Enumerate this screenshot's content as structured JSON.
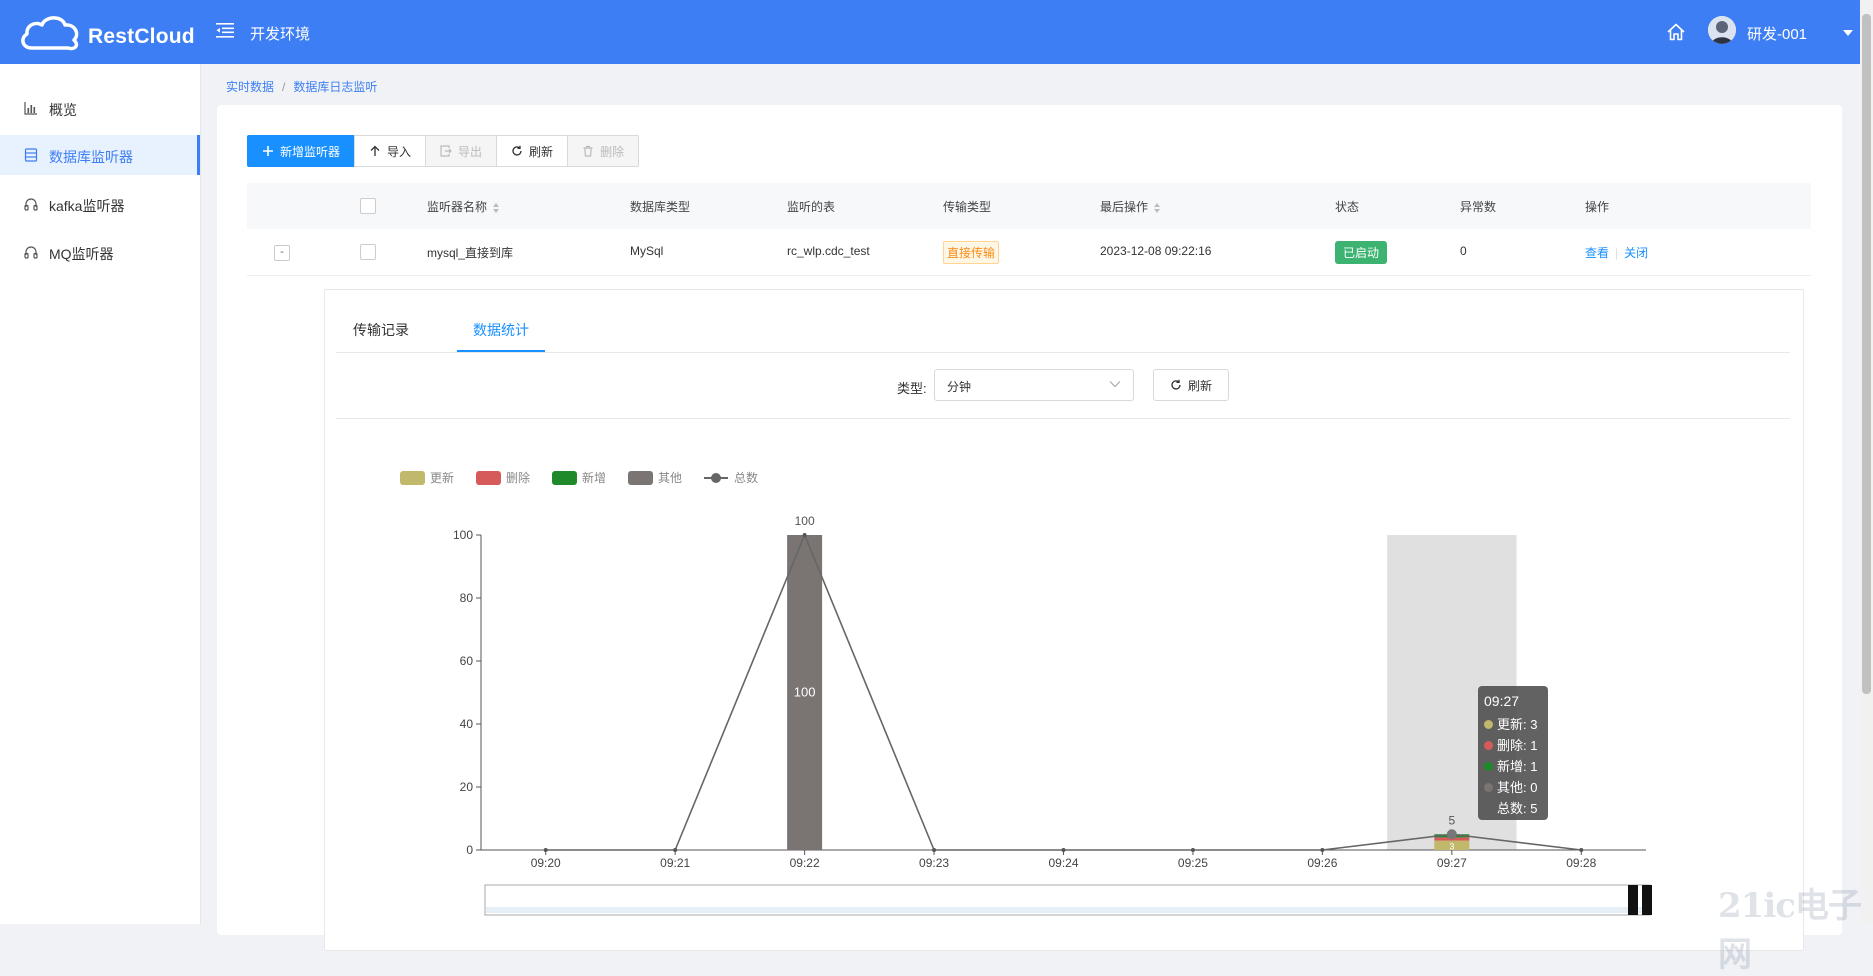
{
  "header": {
    "logo_text": "RestCloud",
    "env_label": "开发环境",
    "user_name": "研发-001",
    "brand_color": "#3d7ef4"
  },
  "sidebar": {
    "items": [
      {
        "label": "概览",
        "icon": "bar-chart-icon",
        "active": false
      },
      {
        "label": "数据库监听器",
        "icon": "database-icon",
        "active": true
      },
      {
        "label": "kafka监听器",
        "icon": "headset-icon",
        "active": false
      },
      {
        "label": "MQ监听器",
        "icon": "headset-icon",
        "active": false
      }
    ]
  },
  "breadcrumb": [
    "实时数据",
    "数据库日志监听"
  ],
  "toolbar": {
    "add": "新增监听器",
    "import": "导入",
    "export": "导出",
    "refresh": "刷新",
    "delete": "删除"
  },
  "table": {
    "headers": [
      "监听器名称",
      "数据库类型",
      "监听的表",
      "传输类型",
      "最后操作",
      "状态",
      "异常数",
      "操作"
    ],
    "rows": [
      {
        "expand": "-",
        "name": "mysql_直接到库",
        "db_type": "MySql",
        "table": "rc_wlp.cdc_test",
        "transfer_type": "直接传输",
        "last_op": "2023-12-08 09:22:16",
        "status": "已启动",
        "errors": "0",
        "action_view": "查看",
        "action_close": "关闭"
      }
    ]
  },
  "detail": {
    "tabs": [
      "传输记录",
      "数据统计"
    ],
    "active_tab": 1,
    "filter_label": "类型:",
    "filter_value": "分钟",
    "refresh": "刷新"
  },
  "chart_data": {
    "type": "bar",
    "categories": [
      "09:20",
      "09:21",
      "09:22",
      "09:23",
      "09:24",
      "09:25",
      "09:26",
      "09:27",
      "09:28"
    ],
    "series": [
      {
        "name": "更新",
        "color": "#c2b86b",
        "values": [
          0,
          0,
          0,
          0,
          0,
          0,
          0,
          3,
          0
        ]
      },
      {
        "name": "删除",
        "color": "#d65a5a",
        "values": [
          0,
          0,
          0,
          0,
          0,
          0,
          0,
          1,
          0
        ]
      },
      {
        "name": "新增",
        "color": "#1f8a2a",
        "values": [
          0,
          0,
          0,
          0,
          0,
          0,
          0,
          1,
          0
        ]
      },
      {
        "name": "其他",
        "color": "#7a7473",
        "values": [
          0,
          0,
          100,
          0,
          0,
          0,
          0,
          0,
          0
        ]
      },
      {
        "name": "总数",
        "type": "line",
        "color": "#666666",
        "values": [
          0,
          0,
          100,
          0,
          0,
          0,
          0,
          5,
          0
        ]
      }
    ],
    "ylim": [
      0,
      100
    ],
    "yticks": [
      "0",
      "20",
      "40",
      "60",
      "80",
      "100"
    ],
    "bar_labels": [
      {
        "category": "09:22",
        "text": "100"
      },
      {
        "category": "09:27",
        "text": "3"
      }
    ],
    "line_labels": [
      {
        "category": "09:22",
        "text": "100"
      },
      {
        "category": "09:27",
        "text": "5"
      }
    ],
    "highlight_category": "09:27",
    "legend_position": "top-left",
    "tooltip": {
      "title": "09:27",
      "rows": [
        {
          "label": "更新: 3",
          "color": "#c2b86b"
        },
        {
          "label": "删除: 1",
          "color": "#d65a5a"
        },
        {
          "label": "新增: 1",
          "color": "#1f8a2a"
        },
        {
          "label": "其他: 0",
          "color": "#7a7473"
        },
        {
          "label": "总数: 5",
          "color": ""
        }
      ]
    }
  },
  "watermark": "21ic电子网"
}
